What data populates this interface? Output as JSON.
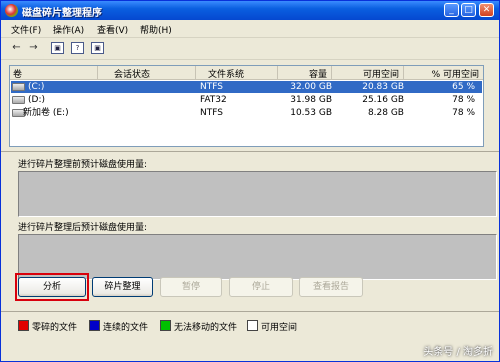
{
  "window": {
    "title": "磁盘碎片整理程序",
    "controls": {
      "minimize": "_",
      "maximize": "□",
      "close": "✕"
    }
  },
  "menu": [
    "文件(F)",
    "操作(A)",
    "查看(V)",
    "帮助(H)"
  ],
  "toolbar": {
    "back_icon": "←",
    "forward_icon": "→",
    "icon3": "▣",
    "icon4": "?",
    "icon5": "▣"
  },
  "volumes": {
    "headers": {
      "volume": "卷",
      "session_status": "会话状态",
      "file_system": "文件系统",
      "capacity": "容量",
      "free_space": "可用空间",
      "percent_free": "% 可用空间"
    },
    "rows": [
      {
        "name": "(C:)",
        "status": "",
        "fs": "NTFS",
        "capacity": "32.00 GB",
        "free": "20.83 GB",
        "percent": "65 %",
        "selected": true
      },
      {
        "name": "(D:)",
        "status": "",
        "fs": "FAT32",
        "capacity": "31.98 GB",
        "free": "25.16 GB",
        "percent": "78 %",
        "selected": false
      },
      {
        "name": "新加卷 (E:)",
        "status": "",
        "fs": "NTFS",
        "capacity": "10.53 GB",
        "free": "8.28 GB",
        "percent": "78 %",
        "selected": false
      }
    ]
  },
  "before_label": "进行碎片整理前预计磁盘使用量:",
  "after_label": "进行碎片整理后预计磁盘使用量:",
  "buttons": {
    "analyze": "分析",
    "defragment": "碎片整理",
    "pause": "暂停",
    "stop": "停止",
    "view_report": "查看报告"
  },
  "legend": [
    {
      "label": "零碎的文件",
      "color": "#E00000"
    },
    {
      "label": "连续的文件",
      "color": "#0000C8"
    },
    {
      "label": "无法移动的文件",
      "color": "#00C000"
    },
    {
      "label": "可用空间",
      "color": "#FFFFFF"
    }
  ],
  "watermark": "头条号 / 淘多折"
}
